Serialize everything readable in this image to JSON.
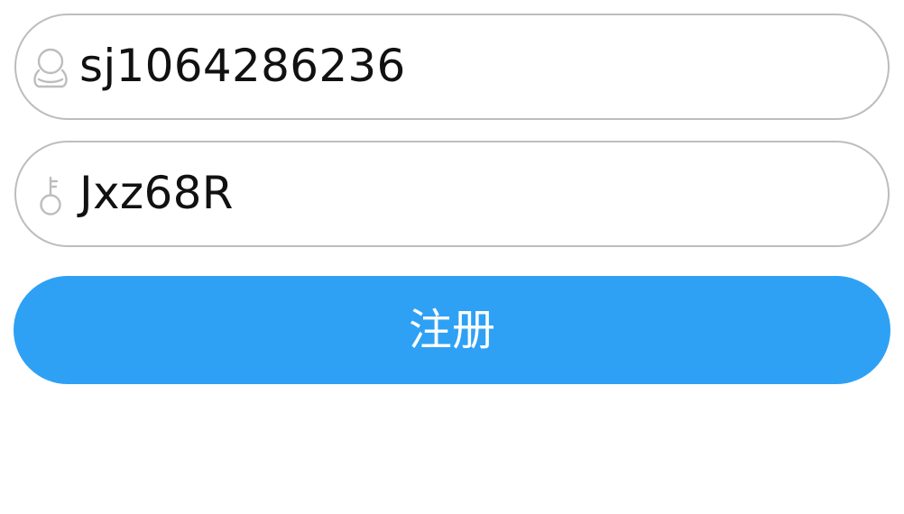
{
  "form": {
    "username": {
      "value": "sj1064286236",
      "icon": "user-icon"
    },
    "password": {
      "value": "Jxz68R",
      "icon": "key-icon"
    },
    "submit_label": "注册"
  },
  "colors": {
    "accent": "#2ea1f5",
    "field_border": "#bdbdbd",
    "icon": "#bdbdbd",
    "text": "#111111"
  }
}
